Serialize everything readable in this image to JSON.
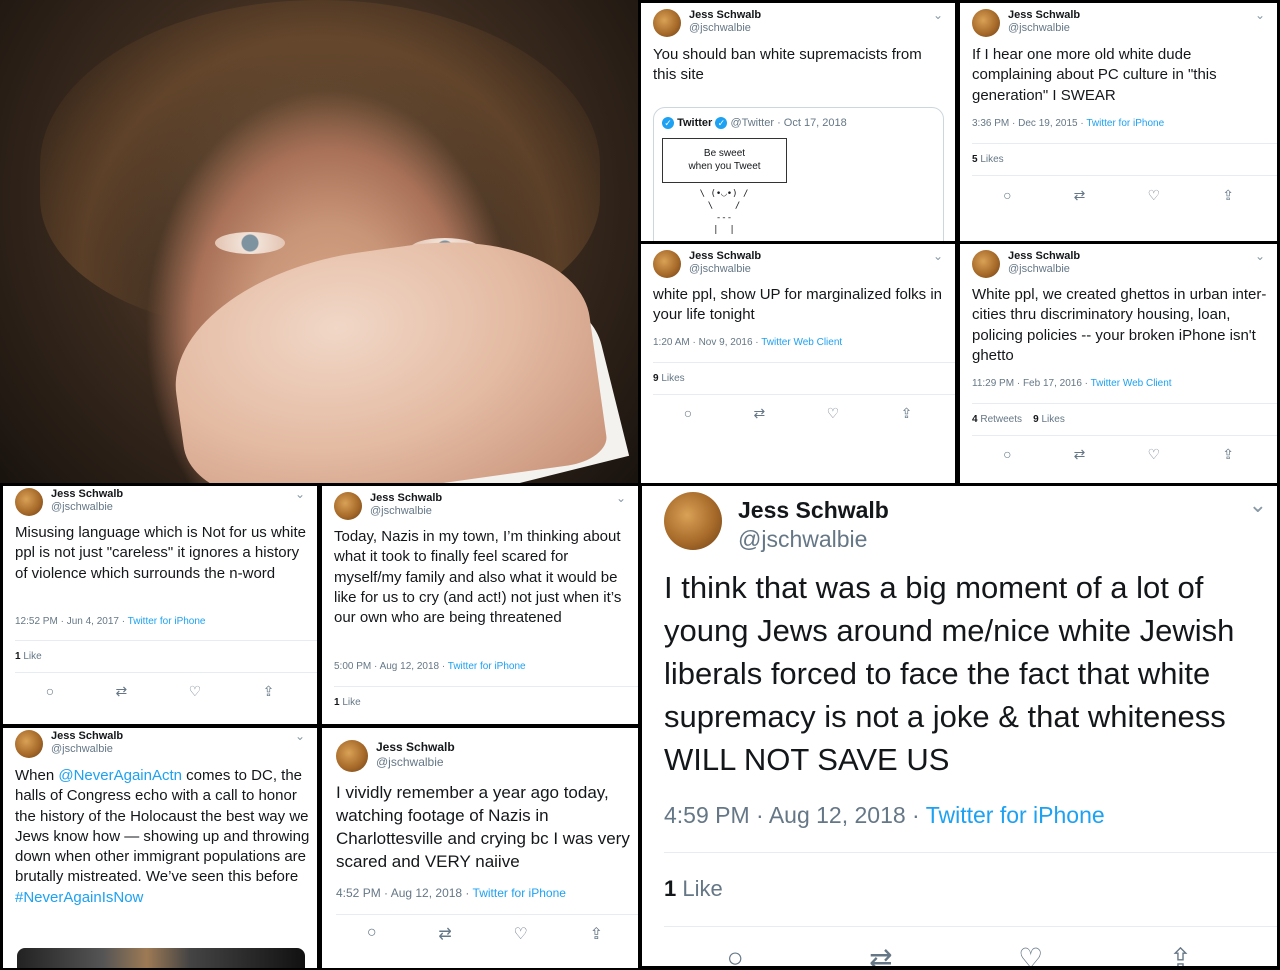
{
  "profile": {
    "name": "Jess Schwalb",
    "handle": "@jschwalbie"
  },
  "icons": {
    "reply": "reply-icon",
    "retweet": "retweet-icon",
    "like": "heart-icon",
    "share": "share-icon",
    "more": "chevron-down-icon"
  },
  "accent": "#1da1f2",
  "tweets": [
    {
      "text": "You should ban white supremacists from this site",
      "quote": {
        "name": "Twitter",
        "handle": "@Twitter",
        "date": "· Oct 17, 2018",
        "line1": "Be sweet",
        "line2": "when you Tweet",
        "art": "\\ (•◡•) /\n\\    /\n---\n|  |"
      }
    },
    {
      "text": "If I hear one more old white dude complaining about PC culture in \"this generation\" I SWEAR",
      "time": "3:36 PM · Dec 19, 2015 · ",
      "source": "Twitter for iPhone",
      "likes_num": "5",
      "likes_label": " Likes"
    },
    {
      "text": "white ppl, show UP for marginalized folks in your life tonight",
      "time": "1:20 AM · Nov 9, 2016 · ",
      "source": "Twitter Web Client",
      "likes_num": "9",
      "likes_label": " Likes"
    },
    {
      "text": "White ppl, we created ghettos in urban inter-cities thru discriminatory housing, loan, policing policies -- your broken iPhone isn't ghetto",
      "time": "11:29 PM · Feb 17, 2016 · ",
      "source": "Twitter Web Client",
      "rt_num": "4",
      "rt_label": " Retweets",
      "likes_num": "9",
      "likes_label": " Likes"
    },
    {
      "text": "Misusing language which is Not for us white ppl is not just \"careless\" it ignores a history of violence which surrounds the n-word",
      "time": "12:52 PM · Jun 4, 2017 · ",
      "source": "Twitter for iPhone",
      "likes_num": "1",
      "likes_label": " Like"
    },
    {
      "text": "Today, Nazis in my town, I’m thinking about what it took to finally feel scared for myself/my family and also what it would be like for us to cry (and act!) not just when it’s our own who are being threatened",
      "time": "5:00 PM · Aug 12, 2018 · ",
      "source": "Twitter for iPhone",
      "likes_num": "1",
      "likes_label": " Like"
    },
    {
      "text_a": "When ",
      "mention": "@NeverAgainActn",
      "text_b": " comes to DC, the halls of Congress echo with a call to honor the history of the Holocaust the best way we Jews know how — showing up and throwing down when other immigrant populations are brutally mistreated. We’ve seen this before ",
      "hashtag": "#NeverAgainIsNow"
    },
    {
      "text": "I vividly remember a year ago today, watching footage of Nazis in Charlottesville and crying bc I was very scared and VERY naiive",
      "time": "4:52 PM · Aug 12, 2018 · ",
      "source": "Twitter for iPhone"
    },
    {
      "text": "I think that was a big moment of a lot of young Jews around me/nice white Jewish liberals forced to face the fact that white supremacy is not a joke & that whiteness WILL NOT SAVE US",
      "time": "4:59 PM · Aug 12, 2018 · ",
      "source": "Twitter for iPhone",
      "likes_num": "1",
      "likes_label": " Like"
    }
  ]
}
